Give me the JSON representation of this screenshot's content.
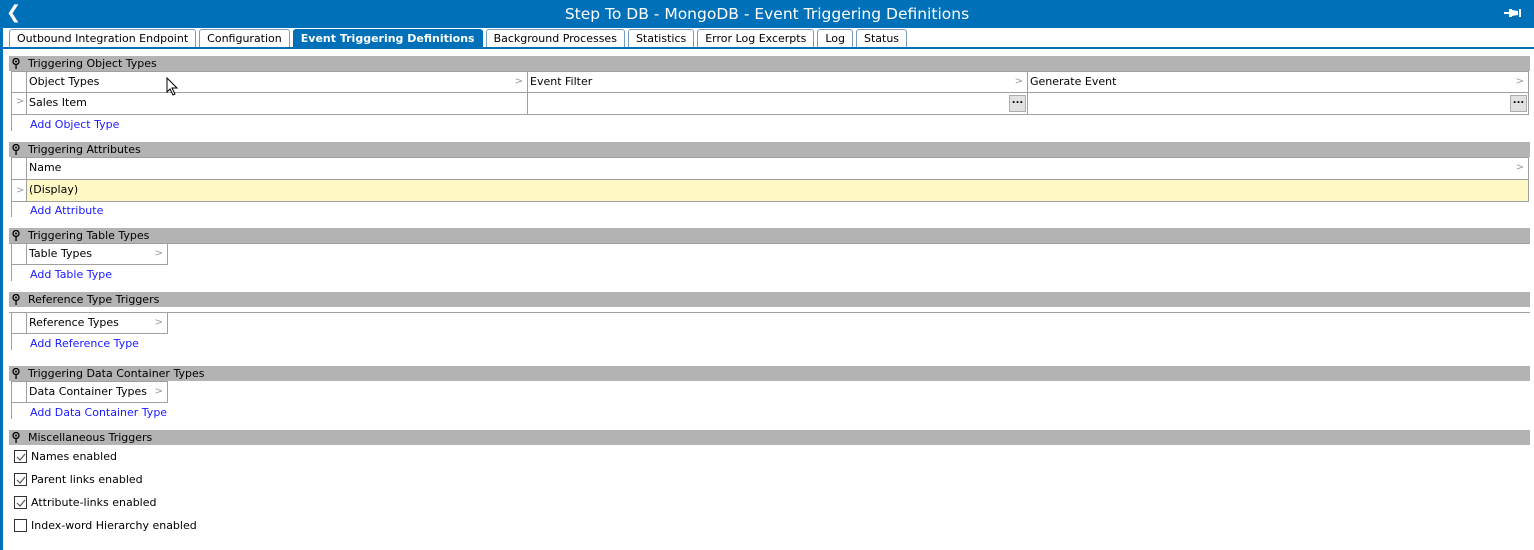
{
  "window": {
    "title": "Step To DB - MongoDB - Event Triggering Definitions",
    "back_icon": "chevron-left-icon",
    "pin_icon": "pin-icon",
    "accent_color": "#0070b8"
  },
  "tabs": [
    {
      "label": "Outbound Integration Endpoint",
      "active": false
    },
    {
      "label": "Configuration",
      "active": false
    },
    {
      "label": "Event Triggering Definitions",
      "active": true
    },
    {
      "label": "Background Processes",
      "active": false
    },
    {
      "label": "Statistics",
      "active": false
    },
    {
      "label": "Error Log Excerpts",
      "active": false
    },
    {
      "label": "Log",
      "active": false
    },
    {
      "label": "Status",
      "active": false
    }
  ],
  "sections": {
    "object_types": {
      "title": "Triggering Object Types",
      "columns": [
        "Object Types",
        "Event Filter",
        "Generate Event"
      ],
      "rows": [
        {
          "object_type": "Sales Item",
          "event_filter": "",
          "generate_event": ""
        }
      ],
      "ellipsis_label": "...",
      "add_link": "Add Object Type"
    },
    "attributes": {
      "title": "Triggering Attributes",
      "columns": [
        "Name"
      ],
      "rows": [
        {
          "name": "(Display)"
        }
      ],
      "add_link": "Add Attribute",
      "selected_row_color": "#fff8c4"
    },
    "table_types": {
      "title": "Triggering Table Types",
      "columns": [
        "Table Types"
      ],
      "add_link": "Add Table Type"
    },
    "reference_types": {
      "title": "Reference Type Triggers",
      "columns": [
        "Reference Types"
      ],
      "add_link": "Add Reference Type"
    },
    "data_container_types": {
      "title": "Triggering Data Container Types",
      "columns": [
        "Data Container Types"
      ],
      "add_link": "Add Data Container Type"
    },
    "misc": {
      "title": "Miscellaneous Triggers",
      "checkboxes": [
        {
          "label": "Names enabled",
          "checked": true
        },
        {
          "label": "Parent links enabled",
          "checked": true
        },
        {
          "label": "Attribute-links enabled",
          "checked": true
        },
        {
          "label": "Index-word Hierarchy enabled",
          "checked": false
        }
      ]
    }
  }
}
